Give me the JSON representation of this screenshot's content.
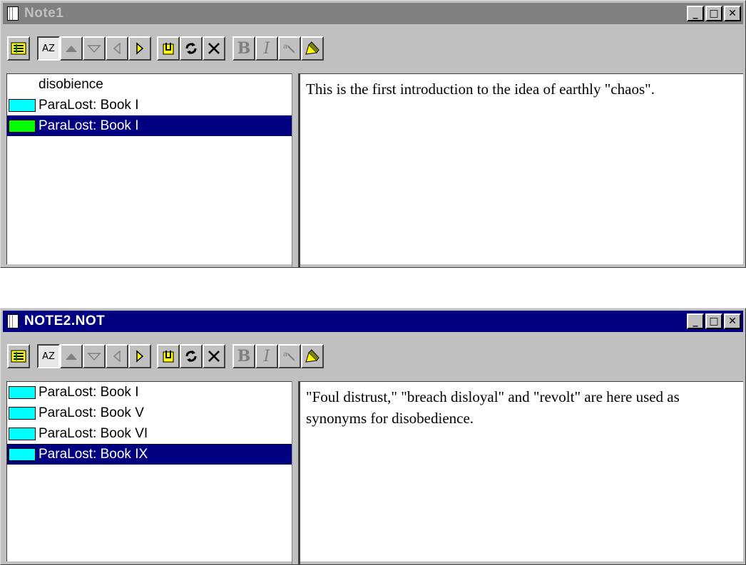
{
  "windows": [
    {
      "title": "Note1",
      "state": "inactive",
      "list": [
        {
          "label": "disobience",
          "color": "",
          "selected": false
        },
        {
          "label": "ParaLost: Book I",
          "color": "#00ffff",
          "selected": false
        },
        {
          "label": "ParaLost: Book I",
          "color": "#00ff00",
          "selected": true
        }
      ],
      "note": "This is the first introduction to the idea of earthly \"chaos\"."
    },
    {
      "title": "NOTE2.NOT",
      "state": "active",
      "list": [
        {
          "label": "ParaLost: Book I",
          "color": "#00ffff",
          "selected": false
        },
        {
          "label": "ParaLost: Book V",
          "color": "#00ffff",
          "selected": false
        },
        {
          "label": "ParaLost: Book VI",
          "color": "#00ffff",
          "selected": false
        },
        {
          "label": "ParaLost: Book IX",
          "color": "#00ffff",
          "selected": true
        }
      ],
      "note": "\"Foul distrust,\" \"breach disloyal\" and \"revolt\" are here used as synonyms for disobedience."
    }
  ],
  "window_buttons": {
    "minimize": "_",
    "maximize": "□",
    "close": "✕"
  },
  "toolbar": {
    "sort_label": "AZ",
    "bold_label": "B",
    "italic_label": "I",
    "icons": [
      "outline-icon",
      "sort-az-icon",
      "move-up-icon",
      "move-down-icon",
      "previous-icon",
      "next-icon",
      "attach-icon",
      "refresh-icon",
      "delete-icon",
      "bold-icon",
      "italic-icon",
      "search-icon",
      "pencil-icon"
    ]
  },
  "colors": {
    "selection": "#000080",
    "active_title": "#000080",
    "inactive_title": "#808080"
  }
}
